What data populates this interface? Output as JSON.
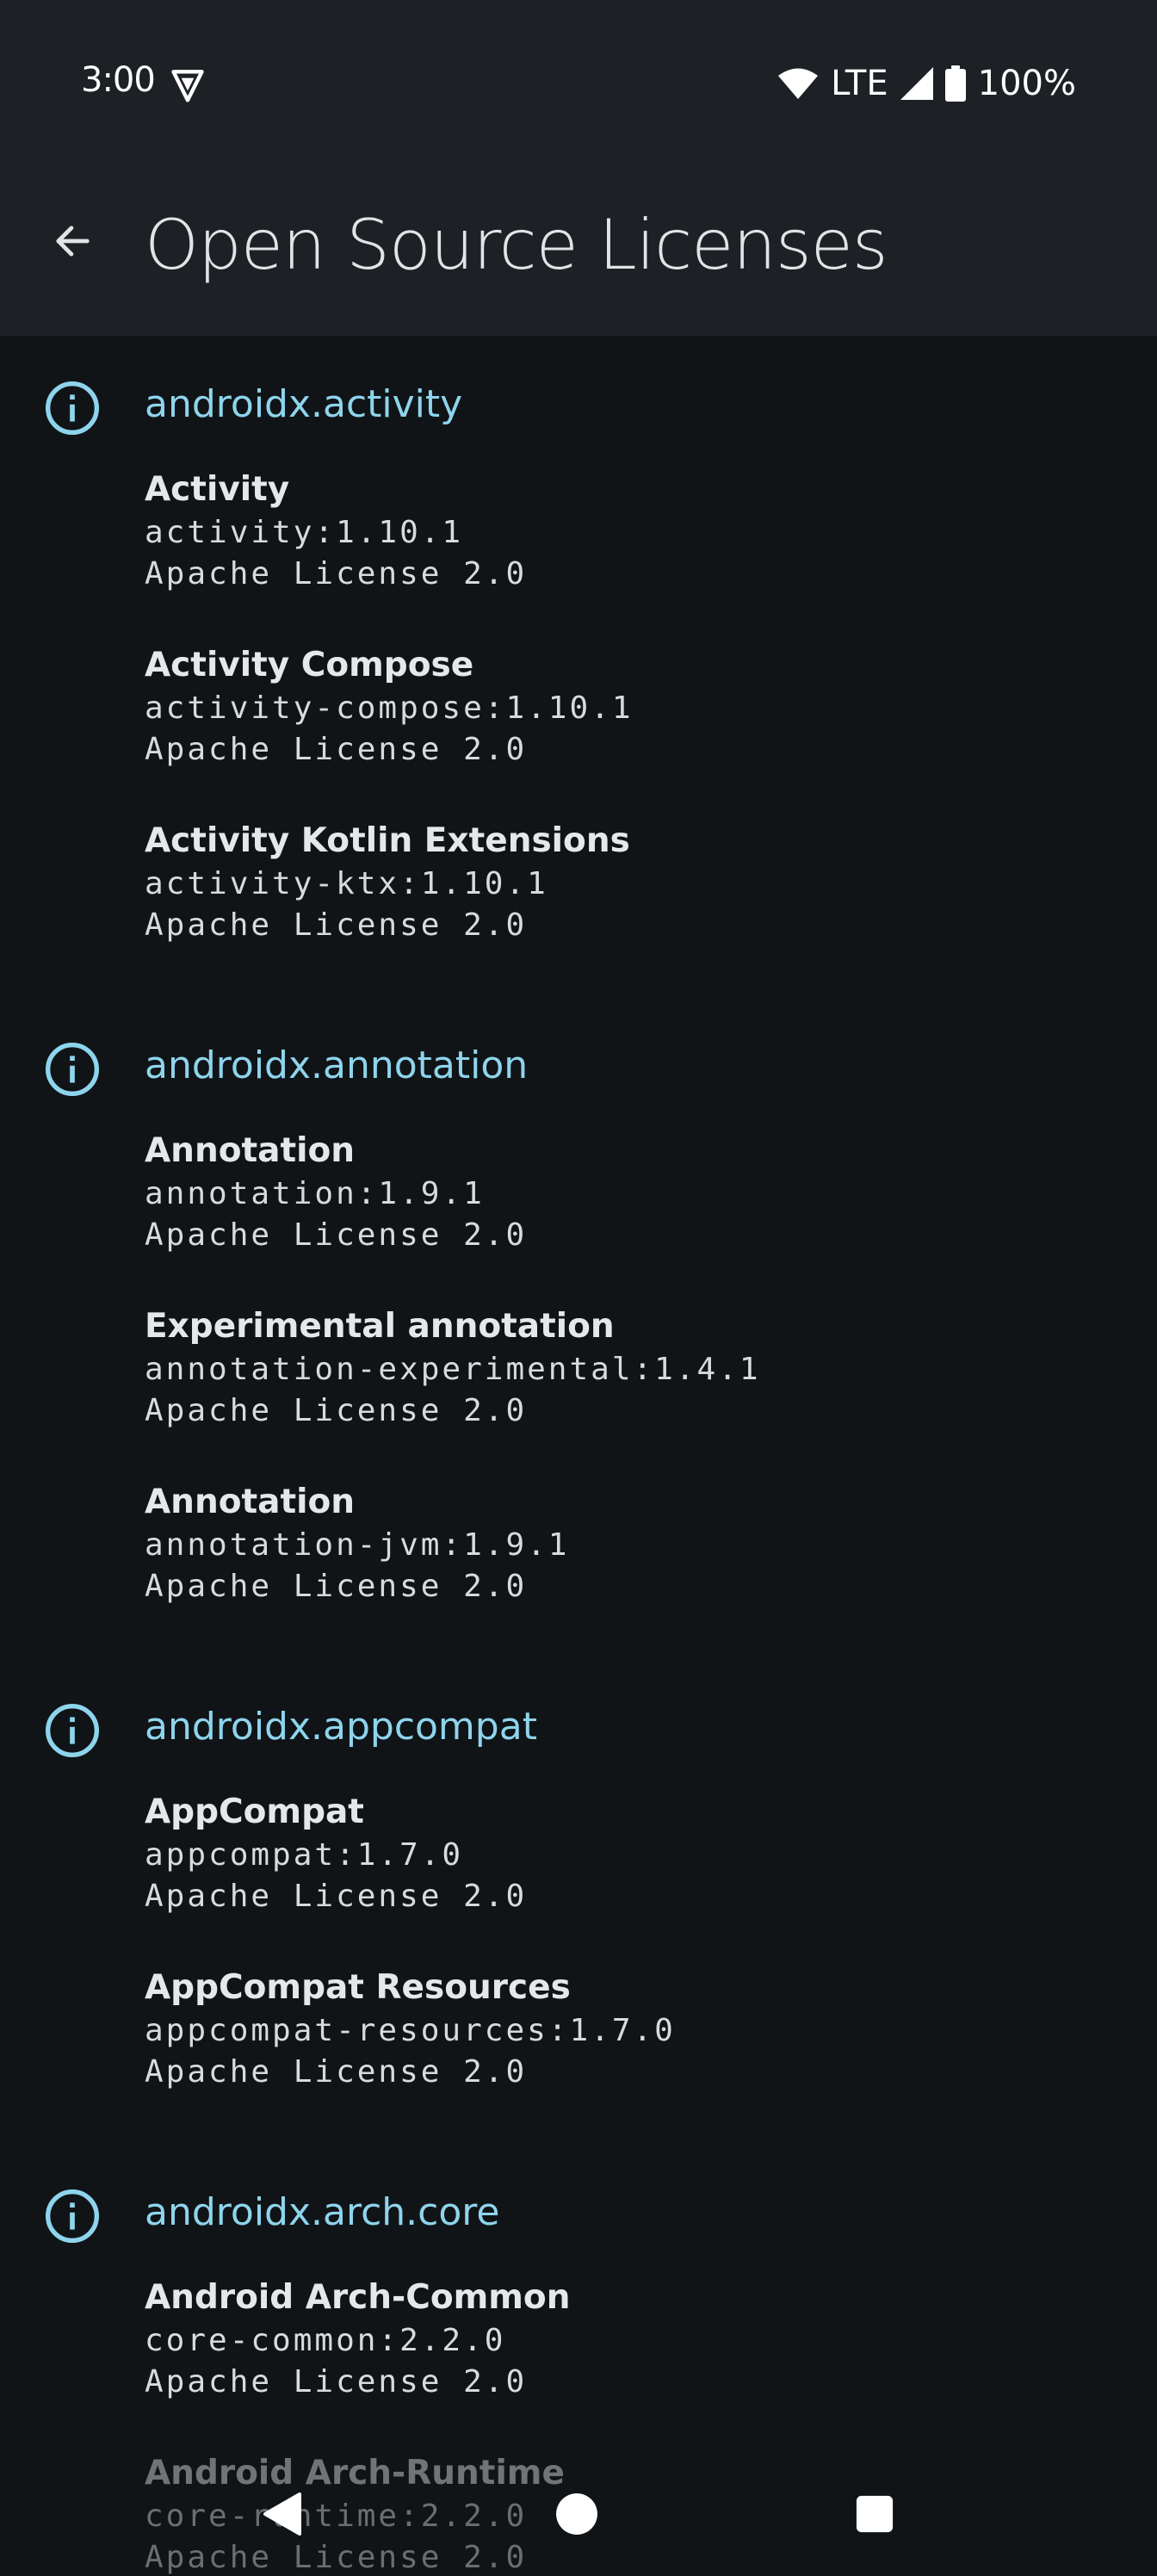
{
  "status_bar": {
    "time": "3:00",
    "network": "LTE",
    "battery": "100%"
  },
  "app_bar": {
    "title": "Open Source Licenses"
  },
  "colors": {
    "accent": "#8ed4ec",
    "background": "#101417",
    "surface": "#1d2125"
  },
  "groups": [
    {
      "name": "androidx.activity",
      "items": [
        {
          "name": "Activity",
          "artifact": "activity:1.10.1",
          "license": "Apache License 2.0"
        },
        {
          "name": "Activity Compose",
          "artifact": "activity-compose:1.10.1",
          "license": "Apache License 2.0"
        },
        {
          "name": "Activity Kotlin Extensions",
          "artifact": "activity-ktx:1.10.1",
          "license": "Apache License 2.0"
        }
      ]
    },
    {
      "name": "androidx.annotation",
      "items": [
        {
          "name": "Annotation",
          "artifact": "annotation:1.9.1",
          "license": "Apache License 2.0"
        },
        {
          "name": "Experimental annotation",
          "artifact": "annotation-experimental:1.4.1",
          "license": "Apache License 2.0"
        },
        {
          "name": "Annotation",
          "artifact": "annotation-jvm:1.9.1",
          "license": "Apache License 2.0"
        }
      ]
    },
    {
      "name": "androidx.appcompat",
      "items": [
        {
          "name": "AppCompat",
          "artifact": "appcompat:1.7.0",
          "license": "Apache License 2.0"
        },
        {
          "name": "AppCompat Resources",
          "artifact": "appcompat-resources:1.7.0",
          "license": "Apache License 2.0"
        }
      ]
    },
    {
      "name": "androidx.arch.core",
      "items": [
        {
          "name": "Android Arch-Common",
          "artifact": "core-common:2.2.0",
          "license": "Apache License 2.0"
        },
        {
          "name": "Android Arch-Runtime",
          "artifact": "core-runtime:2.2.0",
          "license": "Apache License 2.0"
        }
      ]
    }
  ],
  "icons": {
    "back": "arrow-back-icon",
    "info": "info-icon",
    "nav_back": "triangle-back-icon",
    "nav_home": "circle-home-icon",
    "nav_recents": "square-recents-icon"
  }
}
